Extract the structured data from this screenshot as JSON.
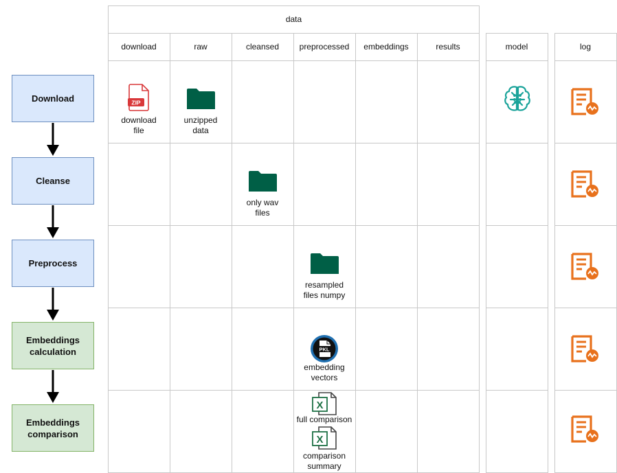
{
  "header": {
    "data": "data",
    "model": "model",
    "log": "log"
  },
  "columns": [
    "download",
    "raw",
    "cleansed",
    "preprocessed",
    "embeddings",
    "results"
  ],
  "stages": [
    {
      "label": "Download",
      "color": "#dae8fc"
    },
    {
      "label": "Cleanse",
      "color": "#dae8fc"
    },
    {
      "label": "Preprocess",
      "color": "#dae8fc"
    },
    {
      "label": "Embeddings calculation",
      "color": "#d5e8d4"
    },
    {
      "label": "Embeddings comparison",
      "color": "#d5e8d4"
    }
  ],
  "artifacts": {
    "download_file": {
      "icon": "zip-file-icon",
      "label": "download\nfile"
    },
    "unzipped_data": {
      "icon": "folder-icon",
      "label": "unzipped\ndata"
    },
    "only_wav": {
      "icon": "folder-icon",
      "label": "only wav\nfiles"
    },
    "resampled": {
      "icon": "folder-icon",
      "label": "resampled\nfiles numpy"
    },
    "embedding_vectors": {
      "icon": "pkl-file-icon",
      "badge": "PKL",
      "label": "embedding\nvectors"
    },
    "full_comparison": {
      "icon": "excel-file-icon",
      "label": "full comparison"
    },
    "comparison_summary": {
      "icon": "excel-file-icon",
      "label": "comparison\nsummary"
    }
  },
  "model_icon": "brain-model-icon",
  "log_icon": "log-file-icon",
  "colors": {
    "folder": "#005f46",
    "log": "#e8711c",
    "zip": "#d9383a",
    "excel": "#1e7145",
    "pkl_ring": "#1f6fb0",
    "model": "#1aa39a",
    "grid": "#c8c8c8"
  }
}
